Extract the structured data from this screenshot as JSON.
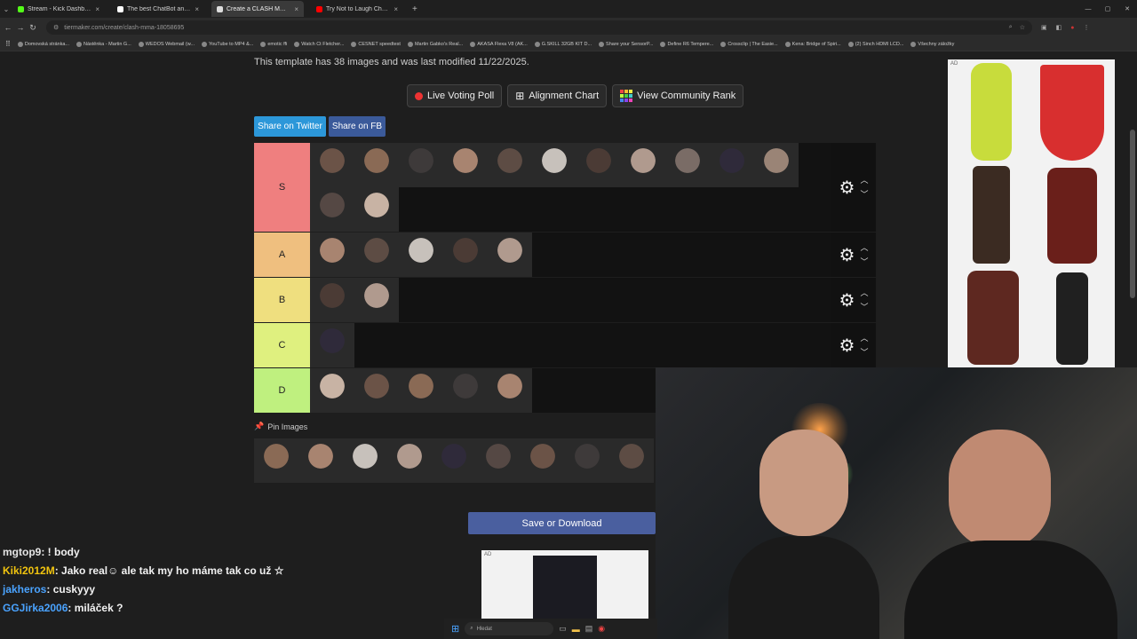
{
  "browser": {
    "tabs": [
      {
        "label": "Stream - Kick Dashboard",
        "color": "#53fc18",
        "active": false
      },
      {
        "label": "The best ChatBot and Widgets",
        "color": "#ffffff",
        "active": false
      },
      {
        "label": "Create a CLASH MMA Tier List",
        "color": "#dddddd",
        "active": true
      },
      {
        "label": "Try Not to Laugh Challenge",
        "color": "#ff0000",
        "active": false
      }
    ],
    "new_tab": "+",
    "url": "tiermaker.com/create/clash-mma-18058695",
    "bookmarks": [
      "Domovská stránka...",
      "Nástěnka - Martin G...",
      "WEDOS Webmail (w...",
      "YouTube to MP4 &...",
      "emotic ffi",
      "Watch Ct Fletcher...",
      "CESNET speedtest",
      "Martin Gabko's Real...",
      "AKASA Flexa V8 (AK...",
      "G.SKILL 32GB KIT D...",
      "Share your SensorP...",
      "Define R6 Tempere...",
      "Crossclip | The Easie...",
      "Kena: Bridge of Spiri...",
      "(2) Sinch HDMI LCD...",
      "Všechny záložky"
    ]
  },
  "template": {
    "meta": "This template has 38 images and was last modified 11/22/2025.",
    "buttons": {
      "poll": "Live Voting Poll",
      "chart": "Alignment Chart",
      "rank": "View Community Rank"
    },
    "share_twitter": "Share on Twitter",
    "share_fb": "Share on FB",
    "tiers": [
      {
        "label": "S",
        "color": "#ef7f7f",
        "count": 13
      },
      {
        "label": "A",
        "color": "#efbf7f",
        "count": 5
      },
      {
        "label": "B",
        "color": "#efdf7f",
        "count": 2
      },
      {
        "label": "C",
        "color": "#dff07f",
        "count": 1
      },
      {
        "label": "D",
        "color": "#bff07f",
        "count": 5
      }
    ],
    "pin_label": "Pin Images",
    "pins_count": 9,
    "save": "Save or Download",
    "ad_tag": "AD"
  },
  "chat": [
    {
      "user": "mgtop9",
      "color": "#e6e6e6",
      "text": ": ! body"
    },
    {
      "user": "Kiki2012M",
      "color": "#f1c40f",
      "text": ": Jako real☺ ale tak my ho máme tak co už ☆"
    },
    {
      "user": "jakheros",
      "color": "#4aa3ff",
      "text": ": cuskyyy"
    },
    {
      "user": "GGJirka2006",
      "color": "#4aa3ff",
      "text": ": miláček ?"
    }
  ],
  "taskbar": {
    "search": "Hledat"
  },
  "colors": {
    "page_bg": "#1e1e1e",
    "twitter": "#2c97d9",
    "facebook": "#3b5a9a",
    "save": "#4a5f9f"
  }
}
